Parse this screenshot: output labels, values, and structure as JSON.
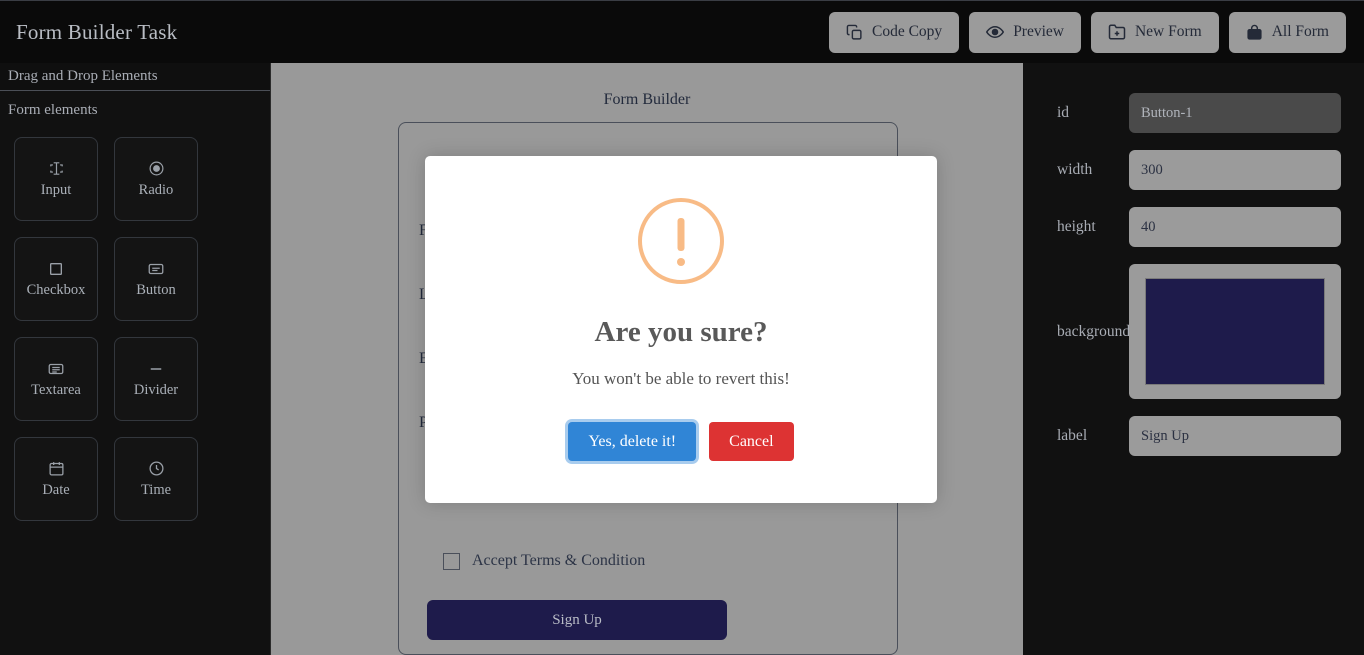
{
  "header": {
    "title": "Form Builder Task",
    "buttons": [
      {
        "label": "Code Copy",
        "icon": "copy-icon"
      },
      {
        "label": "Preview",
        "icon": "eye-icon"
      },
      {
        "label": "New Form",
        "icon": "folder-plus-icon"
      },
      {
        "label": "All Form",
        "icon": "bag-icon"
      }
    ]
  },
  "sidebar": {
    "heading": "Drag and Drop Elements",
    "subheading": "Form elements",
    "items": [
      {
        "label": "Input",
        "icon": "text-cursor-icon"
      },
      {
        "label": "Radio",
        "icon": "radio-dot-icon"
      },
      {
        "label": "Checkbox",
        "icon": "square-icon"
      },
      {
        "label": "Button",
        "icon": "button-icon"
      },
      {
        "label": "Textarea",
        "icon": "textarea-icon"
      },
      {
        "label": "Divider",
        "icon": "minus-icon"
      },
      {
        "label": "Date",
        "icon": "calendar-icon"
      },
      {
        "label": "Time",
        "icon": "clock-icon"
      }
    ]
  },
  "canvas": {
    "title": "Form Builder",
    "fields": [
      {
        "label": "F"
      },
      {
        "label": "L"
      },
      {
        "label": "E"
      },
      {
        "label": "P"
      }
    ],
    "terms_label": "Accept Terms & Condition",
    "submit_label": "Sign Up",
    "submit_background": "#1e1b4b"
  },
  "properties": {
    "rows": [
      {
        "label": "id",
        "value": "Button-1",
        "readonly": true
      },
      {
        "label": "width",
        "value": "300",
        "readonly": false
      },
      {
        "label": "height",
        "value": "40",
        "readonly": false
      }
    ],
    "background": {
      "label": "background",
      "value": "#1e1b4b"
    },
    "label_row": {
      "label": "label",
      "value": "Sign Up"
    }
  },
  "modal": {
    "icon": "warning-icon",
    "title": "Are you sure?",
    "text": "You won't be able to revert this!",
    "confirm_label": "Yes, delete it!",
    "cancel_label": "Cancel",
    "confirm_color": "#3085d6",
    "cancel_color": "#dd3333",
    "icon_color": "#f8bb86"
  }
}
